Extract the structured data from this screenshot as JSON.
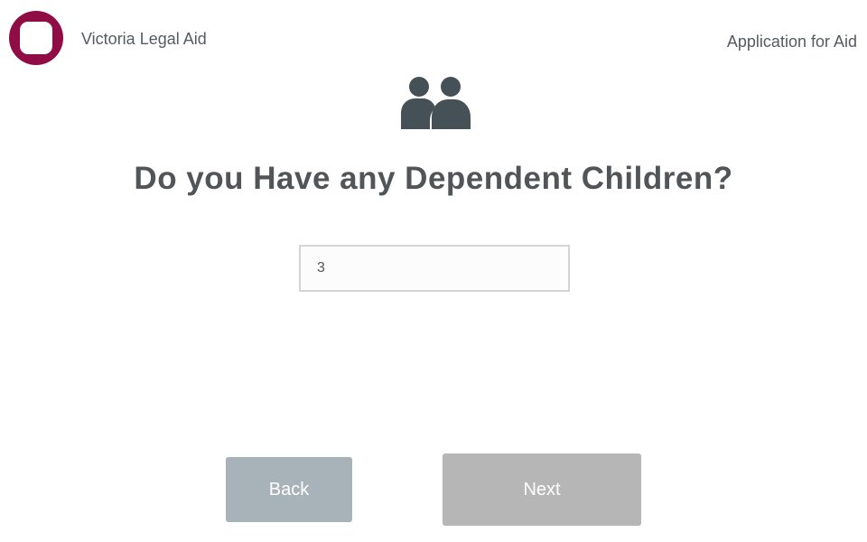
{
  "header": {
    "org_name": "Victoria Legal Aid",
    "app_title": "Application for Aid",
    "logo_color": "#8f0c45"
  },
  "main": {
    "icon": "people-icon",
    "question": "Do you Have any Dependent Children?",
    "answer_value": "3"
  },
  "footer": {
    "back_label": "Back",
    "next_label": "Next"
  },
  "colors": {
    "brand": "#8f0c45",
    "back_button": "#a8b2b9",
    "next_button": "#b6b6b6",
    "icon": "#465057",
    "heading_text": "#525558"
  }
}
